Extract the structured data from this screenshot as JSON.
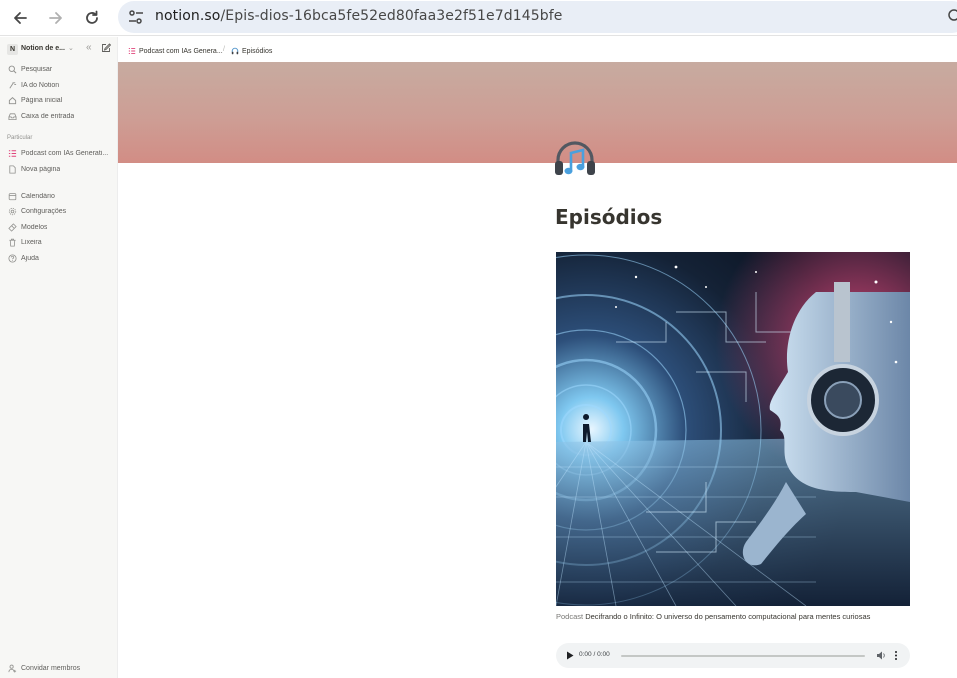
{
  "browser": {
    "url_host": "notion.so",
    "url_path": "/Epis-dios-16bca5fe52ed80faa3e2f51e7d145bfe"
  },
  "sidebar": {
    "workspace_initial": "N",
    "workspace_name": "Notion de e...",
    "top_items": [
      {
        "label": "Pesquisar",
        "icon": "search-icon"
      },
      {
        "label": "IA do Notion",
        "icon": "ai-icon"
      },
      {
        "label": "Página inicial",
        "icon": "home-icon"
      },
      {
        "label": "Caixa de entrada",
        "icon": "inbox-icon"
      }
    ],
    "section_label": "Particular",
    "pages": [
      {
        "label": "Podcast com IAs Generati...",
        "icon": "list-icon"
      },
      {
        "label": "Nova página",
        "icon": "page-icon"
      }
    ],
    "bottom_items": [
      {
        "label": "Calendário",
        "icon": "calendar-icon"
      },
      {
        "label": "Configurações",
        "icon": "gear-icon"
      },
      {
        "label": "Modelos",
        "icon": "templates-icon"
      },
      {
        "label": "Lixeira",
        "icon": "trash-icon"
      },
      {
        "label": "Ajuda",
        "icon": "help-icon"
      }
    ],
    "invite_label": "Convidar membros"
  },
  "breadcrumb": {
    "parent": "Podcast com IAs Genera...",
    "separator": "/",
    "current": "Episódios"
  },
  "page": {
    "title": "Episódios",
    "caption_prefix": "Podcast",
    "caption_text": "Decifrando o Infinito: O universo do pensamento computacional para mentes curiosas"
  },
  "audio": {
    "time": "0:00 / 0:00"
  },
  "colors": {
    "cover_top": "#c7aba0",
    "cover_bottom": "#d28d85",
    "accent_pink": "#e0457b"
  }
}
